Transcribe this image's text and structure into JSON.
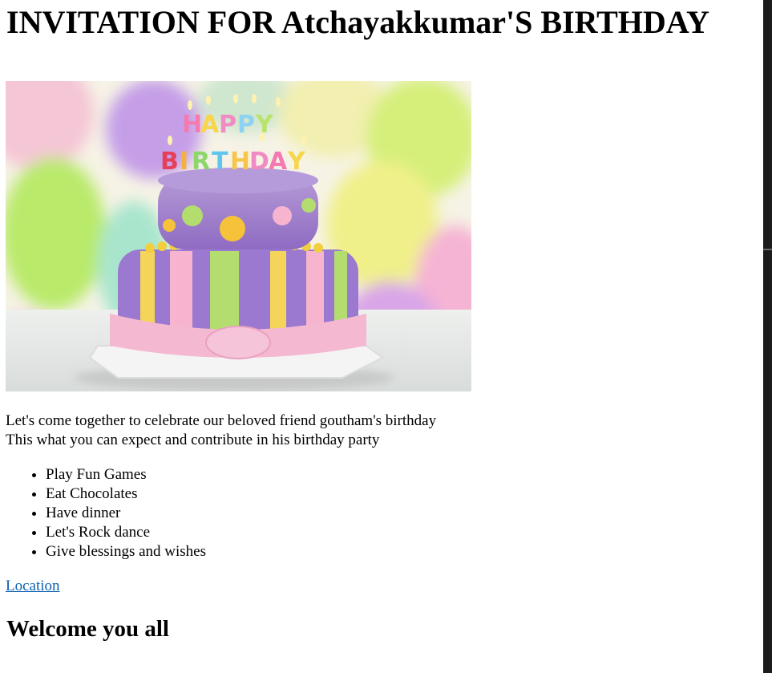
{
  "heading": "INVITATION FOR Atchayakkumar'S BIRTHDAY",
  "image": {
    "alt": "Happy Birthday cake",
    "candle_letters": [
      "H",
      "A",
      "P",
      "P",
      "Y",
      "B",
      "I",
      "R",
      "T",
      "H",
      "D",
      "A",
      "Y"
    ]
  },
  "intro": {
    "line1": "Let's come together to celebrate our beloved friend goutham's birthday",
    "line2": "This what you can expect and contribute in his birthday party"
  },
  "activities": [
    "Play Fun Games",
    "Eat Chocolates",
    "Have dinner",
    "Let's Rock dance",
    "Give blessings and wishes"
  ],
  "location_link": "Location",
  "closing": "Welcome you all",
  "colors": {
    "link": "#0b61b2",
    "scrollbar": "#1c1c1c"
  }
}
